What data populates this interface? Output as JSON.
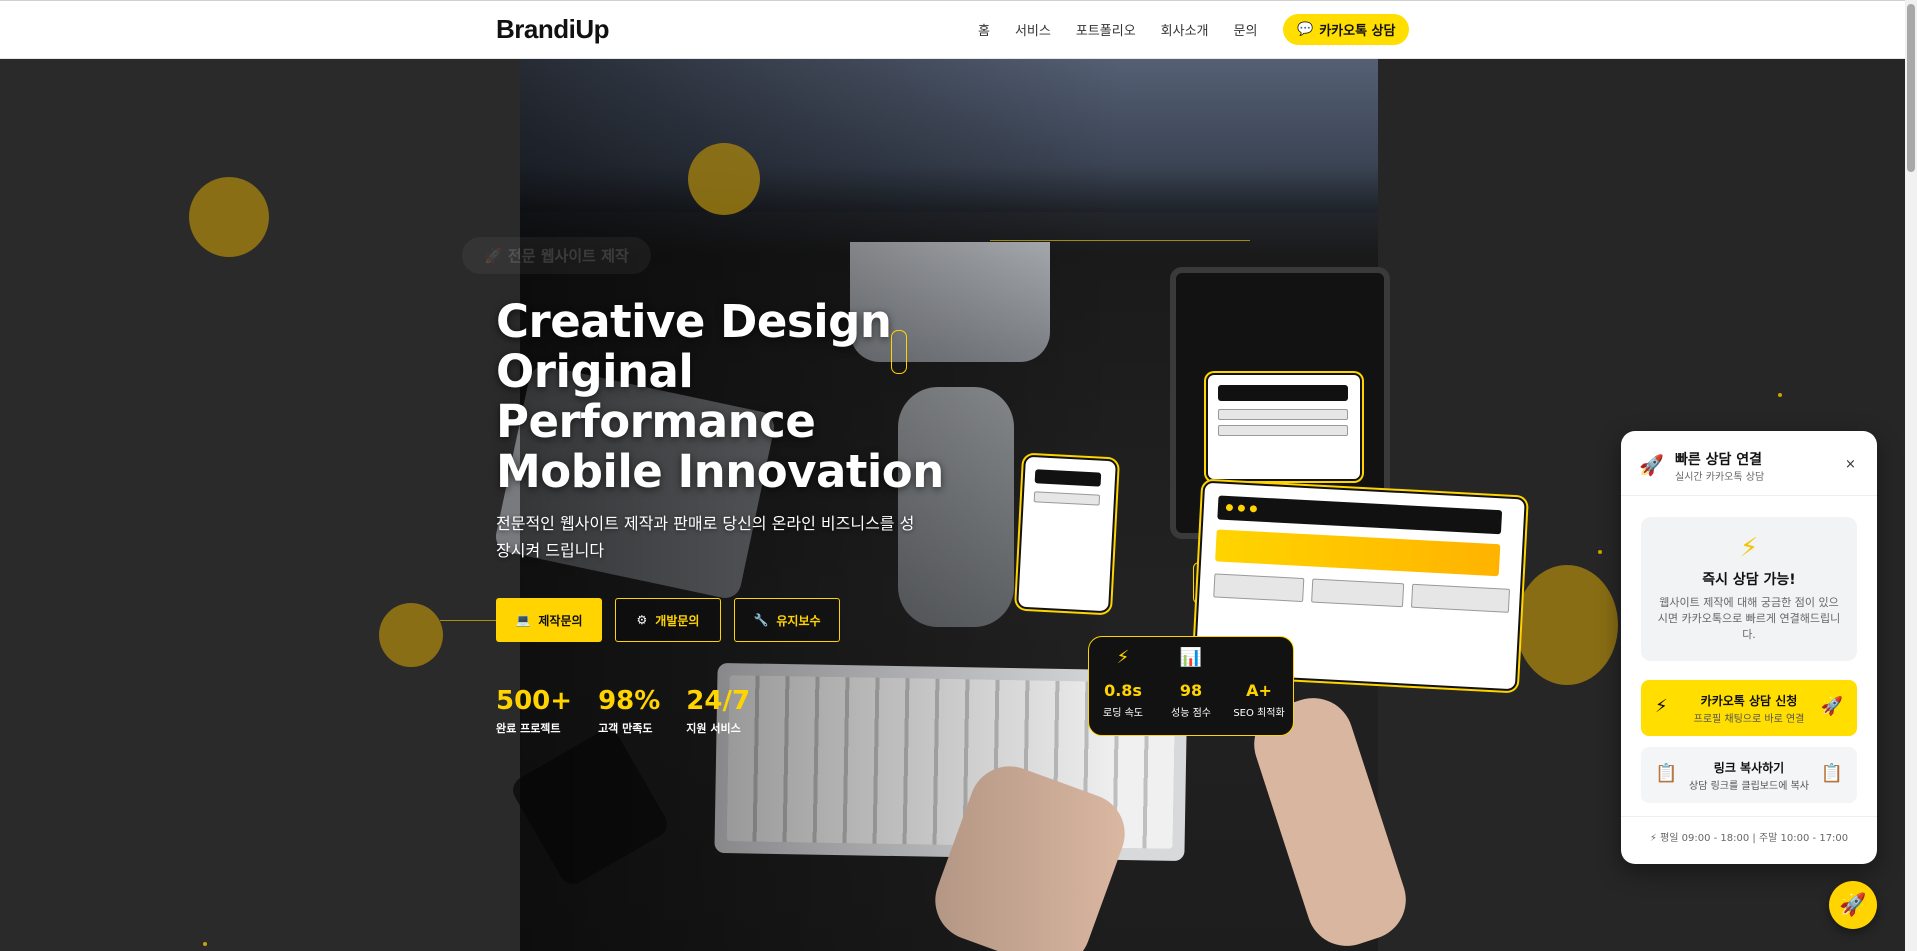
{
  "brand": {
    "logo": "BrandiUp",
    "accent": "#ffd400"
  },
  "nav": {
    "items": [
      "홈",
      "서비스",
      "포트폴리오",
      "회사소개",
      "문의"
    ],
    "cta_label": "카카오톡 상담",
    "cta_icon": "chat-bubble-icon"
  },
  "hero": {
    "badge": "🚀 전문 웹사이트 제작",
    "title_lines": [
      "Creative Design",
      "Original",
      "Performance",
      "Mobile Innovation"
    ],
    "subtitle": "전문적인 웹사이트 제작과 판매로 당신의 온라인 비즈니스를 성장시켜 드립니다",
    "buttons": [
      {
        "label": "제작문의",
        "icon": "laptop-icon"
      },
      {
        "label": "개발문의",
        "icon": "gear-icon"
      },
      {
        "label": "유지보수",
        "icon": "wrench-icon"
      }
    ],
    "stats": [
      {
        "value": "500+",
        "label": "완료 프로젝트"
      },
      {
        "value": "98%",
        "label": "고객 만족도"
      },
      {
        "value": "24/7",
        "label": "지원 서비스"
      }
    ]
  },
  "metrics": [
    {
      "icon": "⚡",
      "value": "0.8s",
      "label": "로딩 속도"
    },
    {
      "icon": "📊",
      "value": "98",
      "label": "성능 점수"
    },
    {
      "icon": "",
      "value": "A+",
      "label": "SEO 최적화"
    }
  ],
  "popup": {
    "title": "빠른 상담 연결",
    "subtitle": "실시간 카카오톡 상담",
    "close": "×",
    "card_title": "즉시 상담 가능!",
    "card_desc": "웹사이트 제작에 대해 궁금한 점이 있으시면 카카오톡으로 빠르게 연결해드립니다.",
    "kakao_title": "카카오톡 상담 신청",
    "kakao_sub": "프로필 채팅으로 바로 연결",
    "copy_title": "링크 복사하기",
    "copy_sub": "상담 링크를 클립보드에 복사",
    "hours": "평일 09:00 - 18:00 | 주말 10:00 - 17:00"
  }
}
